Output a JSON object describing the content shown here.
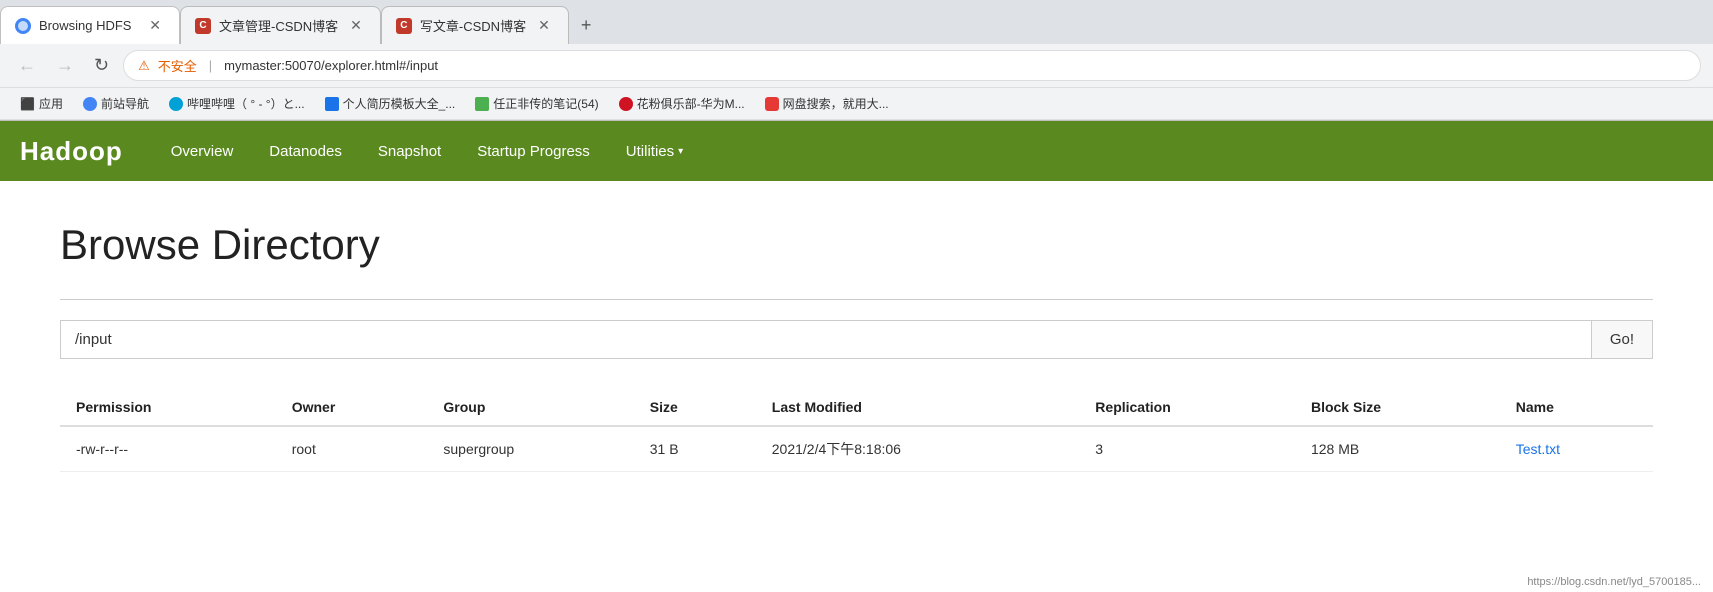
{
  "browser": {
    "tabs": [
      {
        "id": "tab1",
        "label": "Browsing HDFS",
        "favicon_type": "hdfs",
        "active": true
      },
      {
        "id": "tab2",
        "label": "文章管理-CSDN博客",
        "favicon_type": "csdn-red",
        "active": false
      },
      {
        "id": "tab3",
        "label": "写文章-CSDN博客",
        "favicon_type": "csdn-red",
        "active": false
      }
    ],
    "new_tab_label": "+",
    "nav": {
      "back_label": "←",
      "forward_label": "→",
      "refresh_label": "↻",
      "warning_label": "⚠",
      "security_label": "不安全",
      "url": "mymaster:50070/explorer.html#/input"
    },
    "bookmarks": [
      {
        "id": "bk1",
        "icon": "apps",
        "label": "应用"
      },
      {
        "id": "bk2",
        "icon": "blue",
        "label": "前站导航"
      },
      {
        "id": "bk3",
        "icon": "bilibili",
        "label": "哔哩哔哩（ ° - °）と..."
      },
      {
        "id": "bk4",
        "icon": "personal",
        "label": "个人简历模板大全_..."
      },
      {
        "id": "bk5",
        "icon": "green",
        "label": "任正非传的笔记(54)"
      },
      {
        "id": "bk6",
        "icon": "globe",
        "label": "花粉俱乐部-华为M..."
      },
      {
        "id": "bk7",
        "icon": "disk",
        "label": "网盘搜索，就用大..."
      }
    ]
  },
  "hadoop_nav": {
    "logo": "Hadoop",
    "items": [
      {
        "id": "overview",
        "label": "Overview",
        "dropdown": false
      },
      {
        "id": "datanodes",
        "label": "Datanodes",
        "dropdown": false
      },
      {
        "id": "snapshot",
        "label": "Snapshot",
        "dropdown": false
      },
      {
        "id": "startup_progress",
        "label": "Startup Progress",
        "dropdown": false
      },
      {
        "id": "utilities",
        "label": "Utilities",
        "dropdown": true
      }
    ]
  },
  "main": {
    "page_title": "Browse Directory",
    "path_input_value": "/input",
    "go_button_label": "Go!",
    "table": {
      "columns": [
        {
          "id": "permission",
          "label": "Permission"
        },
        {
          "id": "owner",
          "label": "Owner"
        },
        {
          "id": "group",
          "label": "Group"
        },
        {
          "id": "size",
          "label": "Size"
        },
        {
          "id": "last_modified",
          "label": "Last Modified"
        },
        {
          "id": "replication",
          "label": "Replication"
        },
        {
          "id": "block_size",
          "label": "Block Size"
        },
        {
          "id": "name",
          "label": "Name"
        }
      ],
      "rows": [
        {
          "permission": "-rw-r--r--",
          "owner": "root",
          "group": "supergroup",
          "size": "31 B",
          "last_modified": "2021/2/4下午8:18:06",
          "replication": "3",
          "block_size": "128 MB",
          "name": "Test.txt",
          "name_link": true
        }
      ]
    }
  },
  "status_bar": {
    "url": "https://blog.csdn.net/lyd_5700185..."
  }
}
